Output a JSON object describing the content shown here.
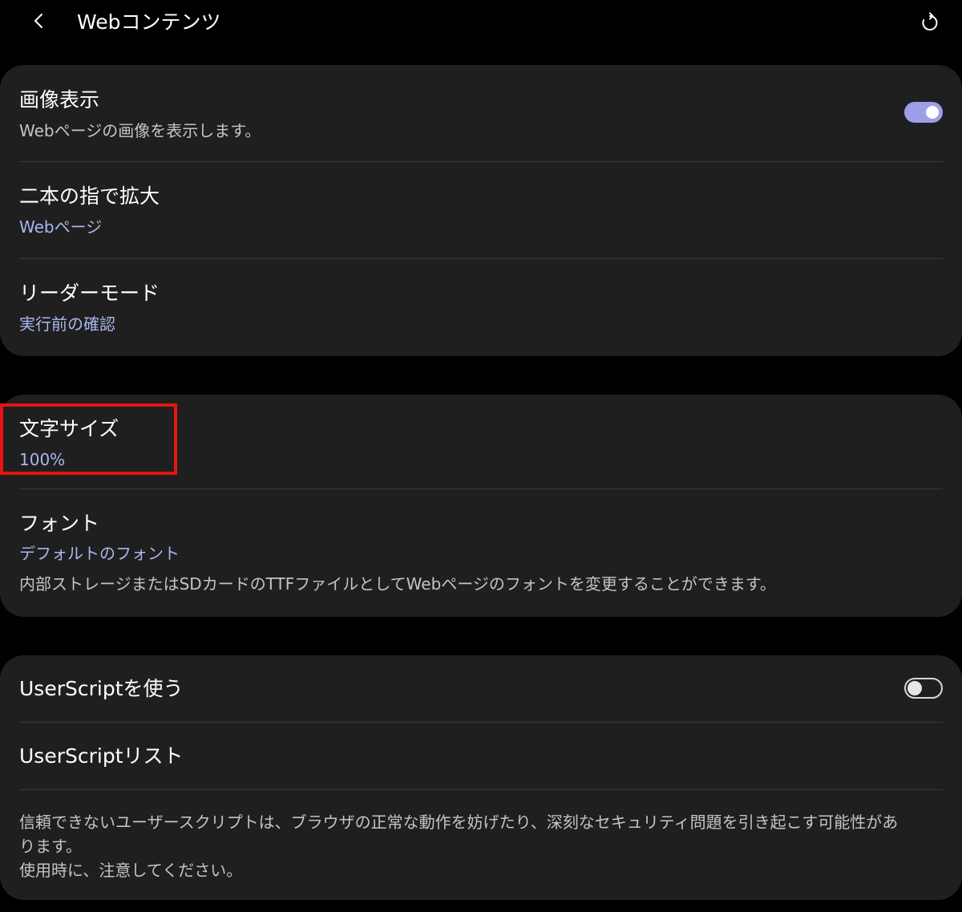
{
  "header": {
    "back_icon": "chevron-left-icon",
    "title": "Webコンテンツ",
    "reset_icon": "refresh-icon"
  },
  "card1": {
    "image_display": {
      "title": "画像表示",
      "subtitle": "Webページの画像を表示します。",
      "toggle_on": true
    },
    "pinch_zoom": {
      "title": "二本の指で拡大",
      "value": "Webページ"
    },
    "reader_mode": {
      "title": "リーダーモード",
      "value": "実行前の確認"
    }
  },
  "card2": {
    "text_size": {
      "title": "文字サイズ",
      "value": "100%"
    },
    "font": {
      "title": "フォント",
      "value": "デフォルトのフォント",
      "description": "内部ストレージまたはSDカードのTTFファイルとしてWebページのフォントを変更することができます。"
    }
  },
  "card3": {
    "use_userscript": {
      "title": "UserScriptを使う",
      "toggle_on": false
    },
    "userscript_list": {
      "title": "UserScriptリスト"
    },
    "warning": {
      "line1": "信頼できないユーザースクリプトは、ブラウザの正常な動作を妨げたり、深刻なセキュリティ問題を引き起こす可能性があ",
      "line2": "ります。",
      "line3": "使用時に、注意してください。"
    }
  },
  "colors": {
    "background": "#000000",
    "card": "#1f1f1f",
    "accent_value": "#a9b7f0",
    "toggle_on": "#9e9ee8",
    "highlight": "#e8140f"
  }
}
